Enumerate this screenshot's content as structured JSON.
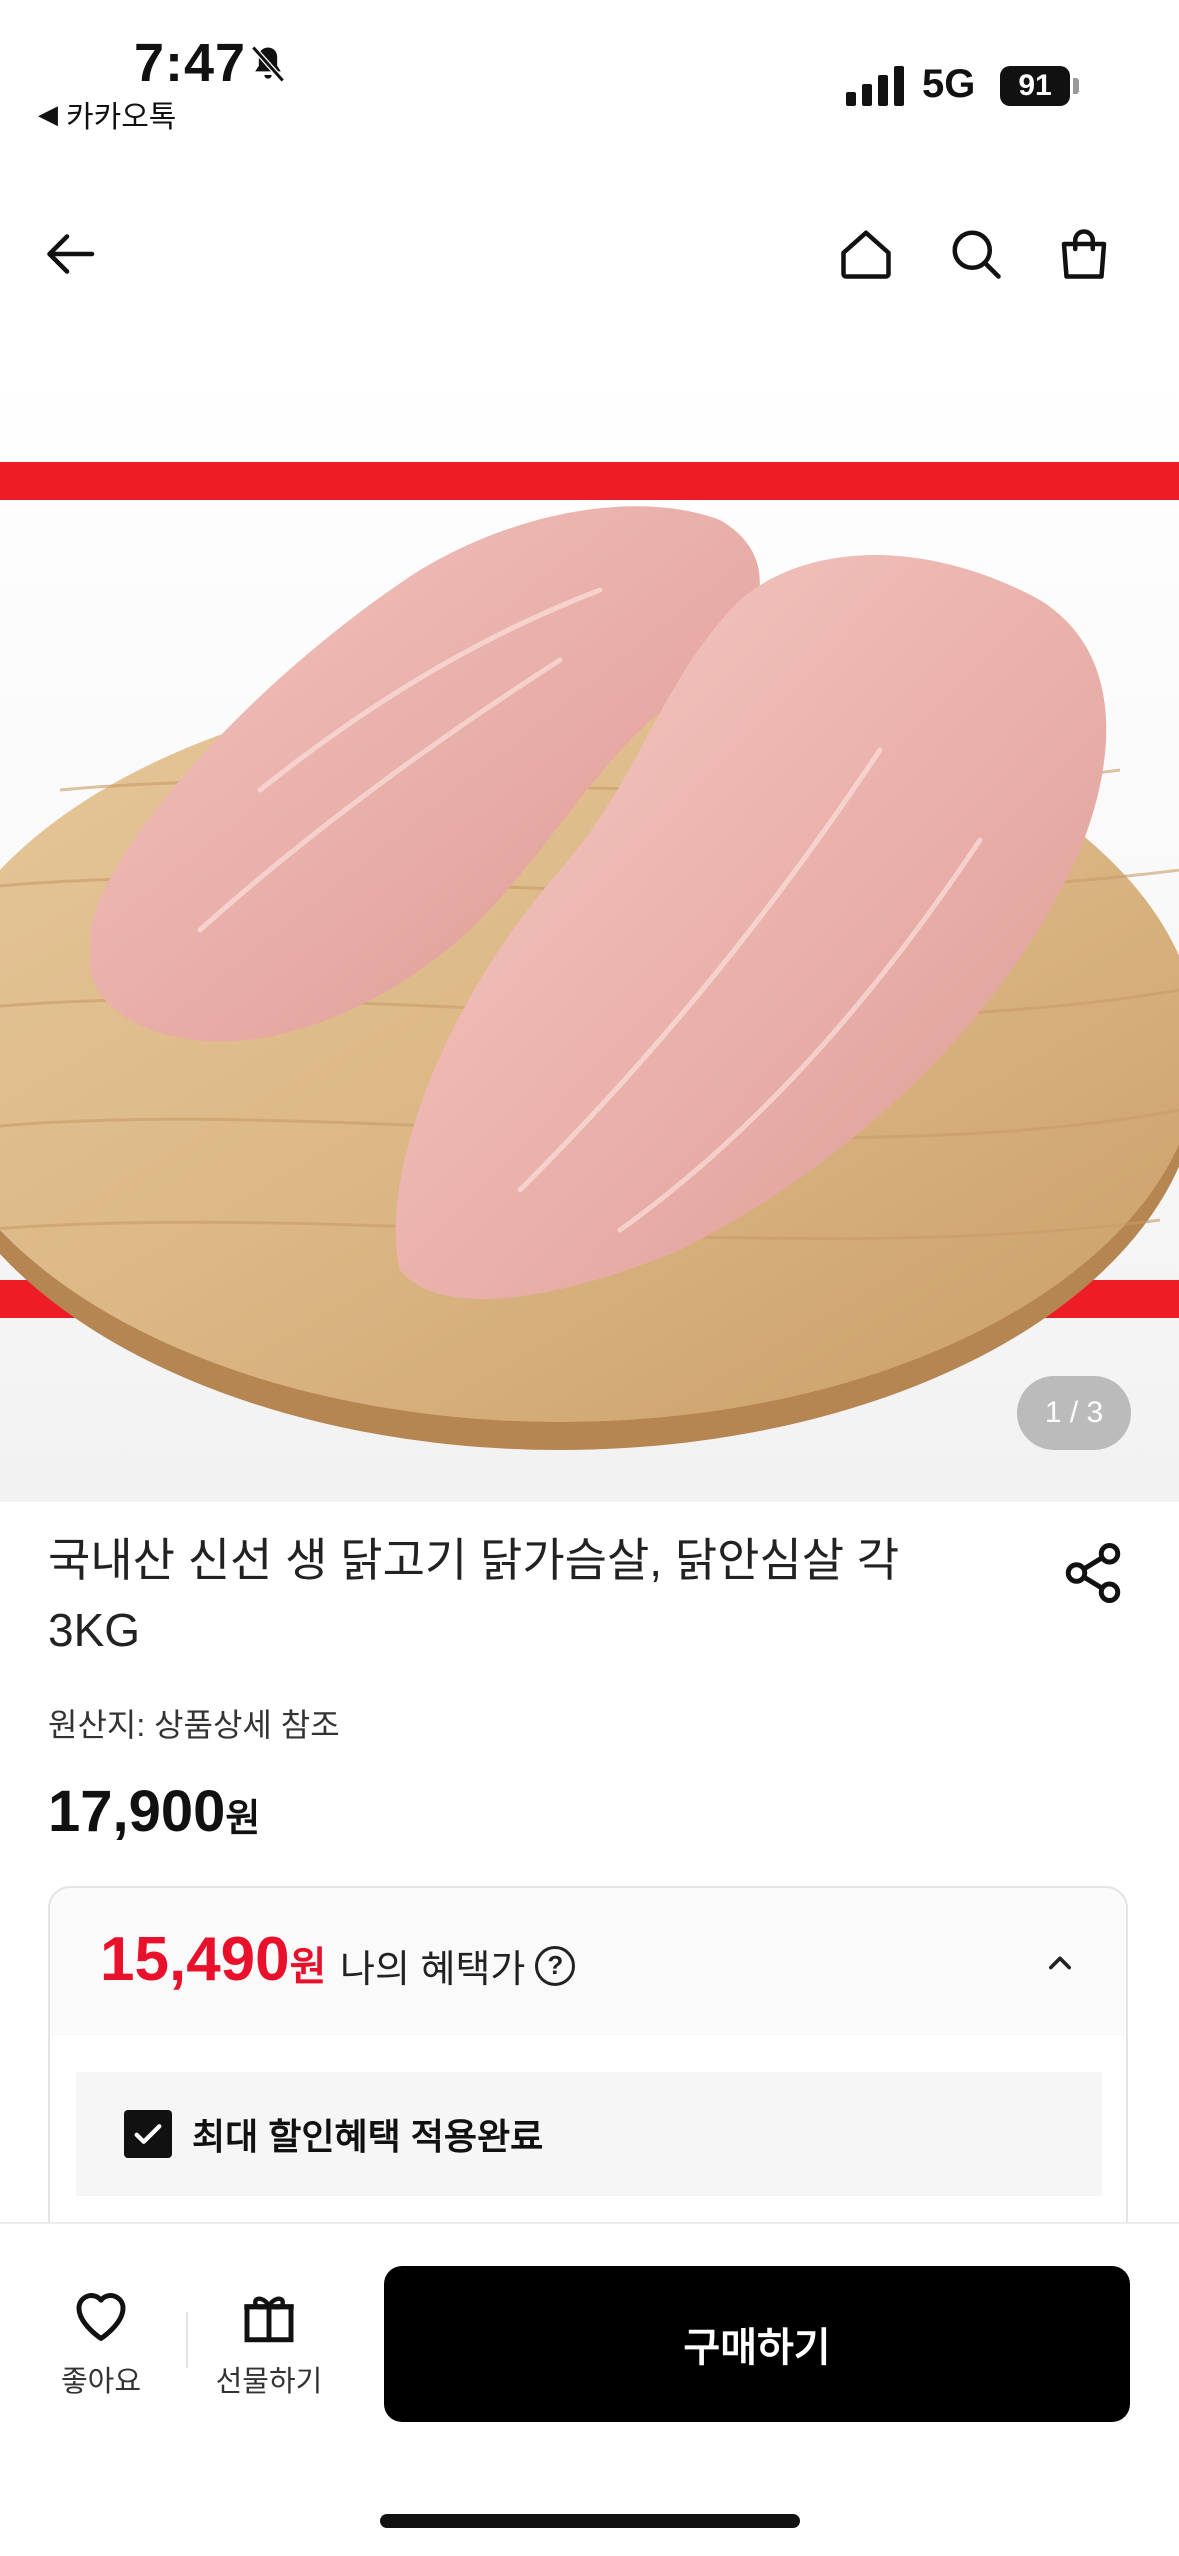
{
  "status_bar": {
    "time": "7:47",
    "back_app": "카카오톡",
    "network": "5G",
    "battery": "91"
  },
  "header": {
    "icons": [
      "back-arrow-icon",
      "home-icon",
      "search-icon",
      "shopping-bag-icon"
    ]
  },
  "product": {
    "image_indicator": "1 / 3",
    "title_line1": "국내산 신선 생 닭고기 닭가슴살, 닭안심살 각",
    "title_line2": "3KG",
    "origin": "원산지: 상품상세 참조",
    "price": "17,900",
    "price_unit": "원"
  },
  "benefit": {
    "price": "15,490",
    "price_unit": "원",
    "label": "나의 혜택가",
    "help": "?",
    "check_label": "최대 할인혜택 적용완료",
    "price_color": "#e8102a"
  },
  "bottom_bar": {
    "like_label": "좋아요",
    "gift_label": "선물하기",
    "buy_label": "구매하기"
  }
}
